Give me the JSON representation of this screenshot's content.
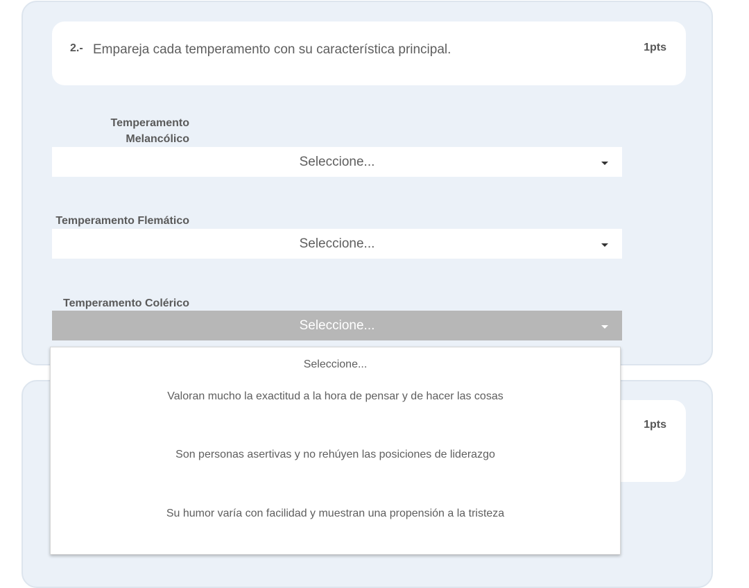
{
  "question1": {
    "number": "2.-",
    "text": "Empareja cada temperamento con su característica principal.",
    "points": "1pts",
    "items": [
      {
        "label_line1": "Temperamento",
        "label_line2": "Melancólico",
        "value": "Seleccione..."
      },
      {
        "label": "Temperamento Flemático",
        "value": "Seleccione..."
      },
      {
        "label": "Temperamento Colérico",
        "value": "Seleccione..."
      }
    ]
  },
  "question2": {
    "points": "1pts"
  },
  "dropdown": {
    "options": [
      "Seleccione...",
      "Valoran mucho la exactitud a la hora de pensar y de hacer las cosas",
      "Son personas asertivas y no rehúyen las posiciones de liderazgo",
      "Su humor varía con facilidad y muestran una propensión a la tristeza"
    ]
  },
  "icons": {
    "caret": "chevron-down-icon"
  },
  "colors": {
    "card_bg": "#ebf1f8",
    "active_select": "#b7b7b7"
  }
}
